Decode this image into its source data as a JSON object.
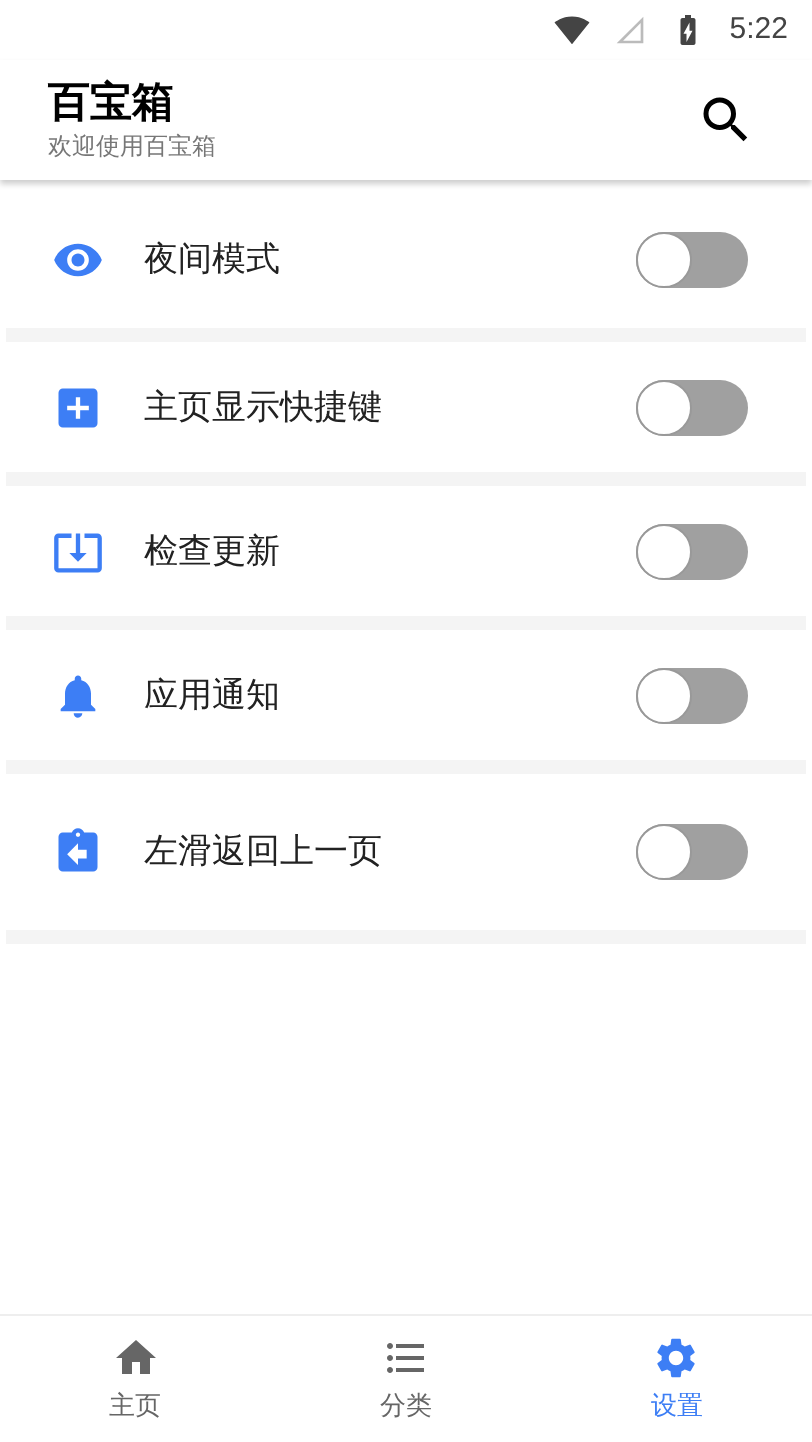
{
  "status_bar": {
    "time": "5:22"
  },
  "app_bar": {
    "title": "百宝箱",
    "subtitle": "欢迎使用百宝箱"
  },
  "settings": [
    {
      "label": "夜间模式",
      "on": false
    },
    {
      "label": "主页显示快捷键",
      "on": false
    },
    {
      "label": "检查更新",
      "on": false
    },
    {
      "label": "应用通知",
      "on": false
    },
    {
      "label": "左滑返回上一页",
      "on": false
    }
  ],
  "bottom_nav": [
    {
      "label": "主页",
      "selected": false
    },
    {
      "label": "分类",
      "selected": false
    },
    {
      "label": "设置",
      "selected": true
    }
  ]
}
